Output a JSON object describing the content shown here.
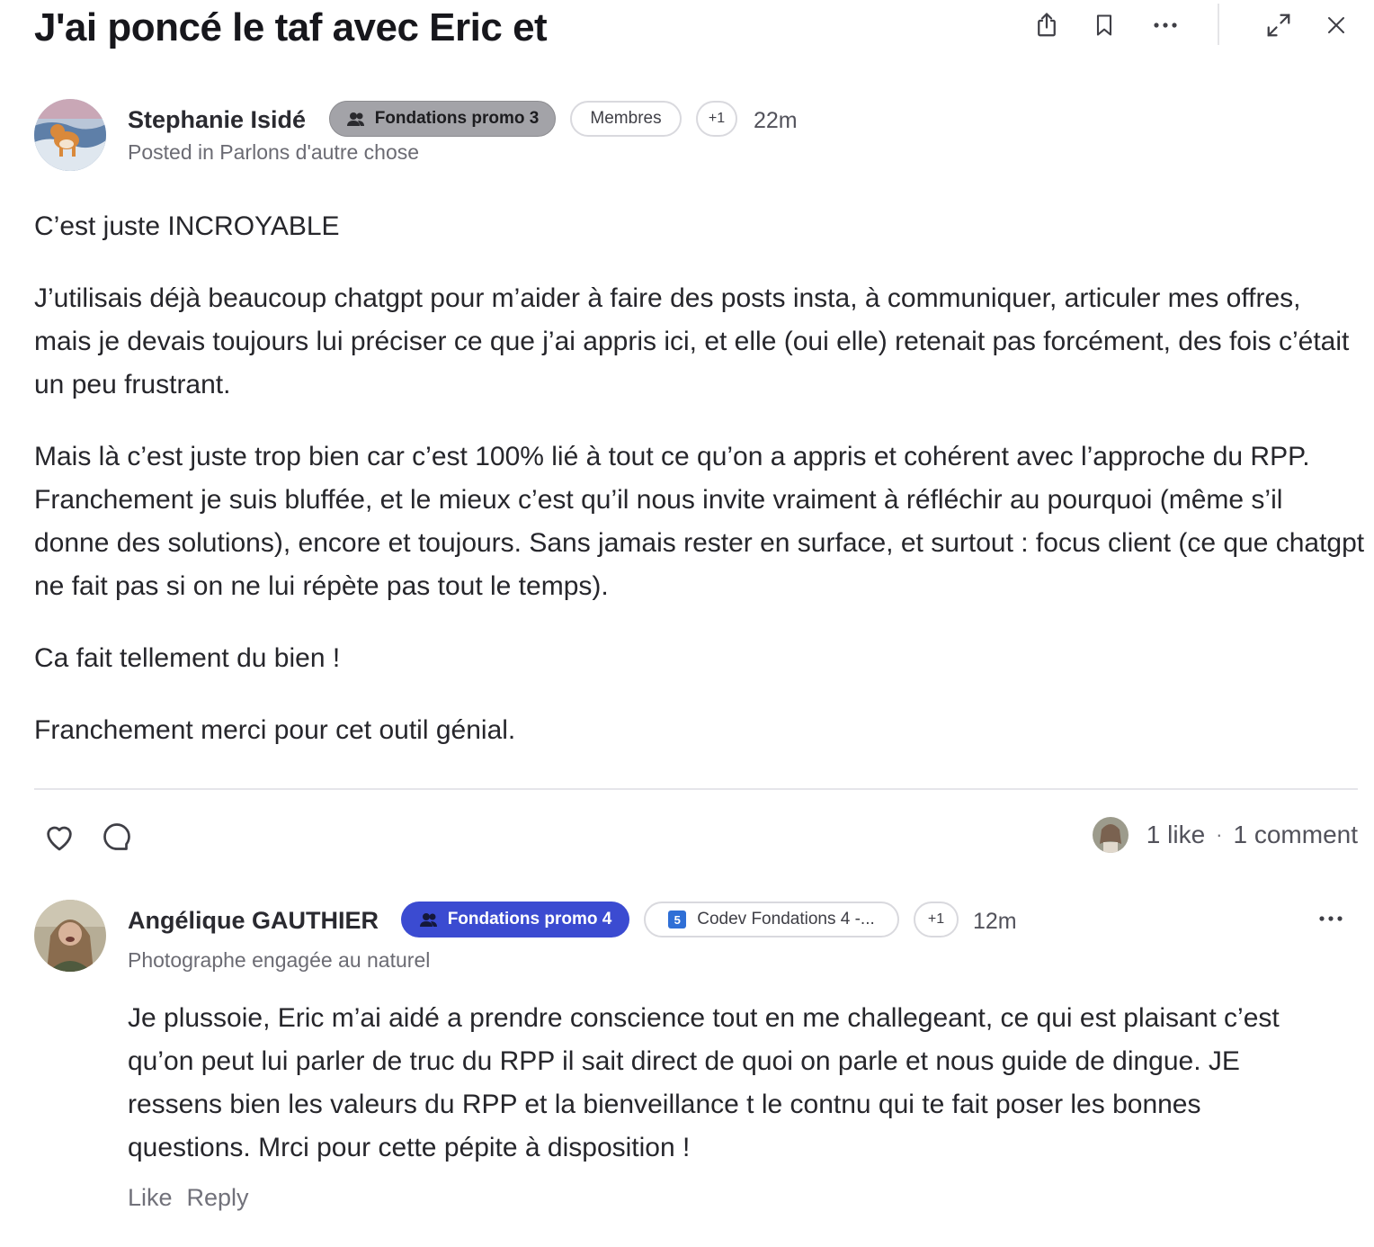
{
  "post": {
    "title": "J'ai poncé le taf avec Eric et",
    "author": "Stephanie Isidé",
    "badges": [
      "Fondations promo 3",
      "Membres",
      "+1"
    ],
    "time": "22m",
    "posted_in_label": "Posted in Parlons d'autre chose",
    "body": [
      "C’est juste INCROYABLE",
      "J’utilisais déjà beaucoup chatgpt pour m’aider à faire des posts insta, à communiquer, articuler mes offres, mais je devais toujours lui préciser ce que j’ai appris ici, et elle (oui elle) retenait pas forcément, des fois c’était un peu frustrant.",
      "Mais là c’est juste trop bien car c’est 100% lié à tout ce qu’on a appris et cohérent avec l’approche du RPP. Franchement je suis bluffée, et le mieux c’est qu’il nous invite vraiment à réfléchir au pourquoi (même s’il donne des solutions), encore et toujours. Sans jamais rester en surface, et surtout : focus client (ce que chatgpt ne fait pas si on ne lui répète pas tout le temps).",
      "Ca fait tellement du bien !",
      "Franchement merci pour cet outil génial."
    ]
  },
  "header": {
    "icons": [
      "share-icon",
      "bookmark-icon",
      "more-icon",
      "expand-icon",
      "close-icon"
    ]
  },
  "stats": {
    "likes": "1 like",
    "separator": "·",
    "comments": "1 comment"
  },
  "comment": {
    "author": "Angélique GAUTHIER",
    "badges": [
      "Fondations promo 4",
      "Codev Fondations 4 -...",
      "+1"
    ],
    "codev_icon_letter": "5",
    "time": "12m",
    "headline": "Photographe engagée au naturel",
    "body": "Je plussoie, Eric m’ai aidé a prendre conscience tout en me challegeant, ce qui est plaisant c’est qu’on peut lui parler de truc du RPP il sait direct de quoi on parle et nous guide de dingue. JE ressens bien les valeurs du RPP et la bienveillance t le contnu qui te fait poser les bonnes questions. Mrci pour cette pépite à disposition !",
    "like_label": "Like",
    "reply_label": "Reply"
  },
  "colors": {
    "chip_gray": "#a3a3a8",
    "chip_blue": "#3b4bd1",
    "text": "#26262b",
    "muted": "#6b6b73"
  }
}
